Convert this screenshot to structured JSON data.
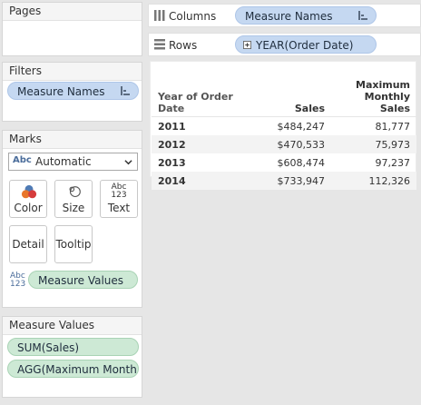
{
  "pages": {
    "title": "Pages"
  },
  "filters": {
    "title": "Filters",
    "pill": "Measure Names"
  },
  "marks": {
    "title": "Marks",
    "dropdown_value": "Automatic",
    "dropdown_icon_text": "Abc",
    "buttons": {
      "color": "Color",
      "size": "Size",
      "text": "Text",
      "detail": "Detail",
      "tooltip": "Tooltip"
    },
    "text_icon_top": "Abc",
    "text_icon_bottom": "123",
    "measure_values_pill": "Measure Values"
  },
  "measure_values_card": {
    "title": "Measure Values",
    "pills": [
      "SUM(Sales)",
      "AGG(Maximum Month.."
    ]
  },
  "columns_shelf": {
    "label": "Columns",
    "pill": "Measure Names"
  },
  "rows_shelf": {
    "label": "Rows",
    "pill": "YEAR(Order Date)"
  },
  "table": {
    "row_header_line1": "Year of Order",
    "row_header_line2": "Date",
    "col1_header": "Sales",
    "col2_header_line1": "Maximum Monthly",
    "col2_header_line2": "Sales",
    "rows": [
      {
        "year": "2011",
        "sales": "$484,247",
        "max": "81,777"
      },
      {
        "year": "2012",
        "sales": "$470,533",
        "max": "75,973"
      },
      {
        "year": "2013",
        "sales": "$608,474",
        "max": "97,237"
      },
      {
        "year": "2014",
        "sales": "$733,947",
        "max": "112,326"
      }
    ]
  },
  "colors": {
    "blue_pill": "#c5d8f1",
    "green_pill": "#cde9d5",
    "background": "#e6e6e6"
  }
}
